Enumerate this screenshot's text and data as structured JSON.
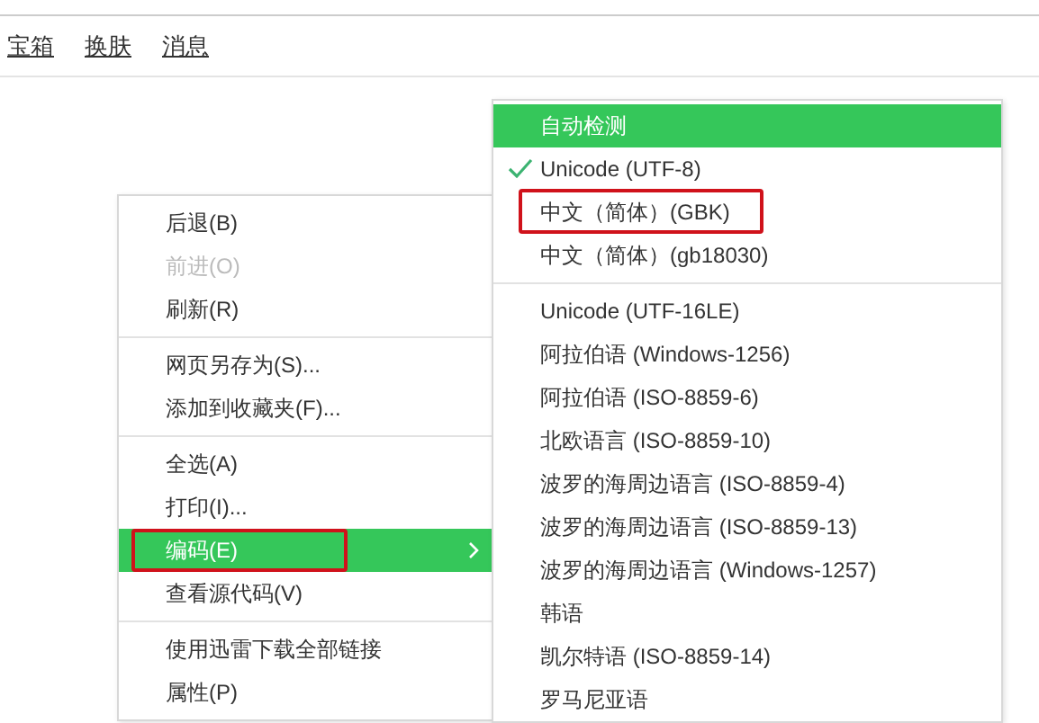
{
  "menu_bar": [
    {
      "label": "宝箱"
    },
    {
      "label": "换肤"
    },
    {
      "label": "消息"
    }
  ],
  "context_menu": {
    "groups": [
      [
        {
          "label": "后退(B)",
          "disabled": false,
          "selected": false,
          "annotated": false
        },
        {
          "label": "前进(O)",
          "disabled": true,
          "selected": false,
          "annotated": false
        },
        {
          "label": "刷新(R)",
          "disabled": false,
          "selected": false,
          "annotated": false
        }
      ],
      [
        {
          "label": "网页另存为(S)...",
          "disabled": false,
          "selected": false,
          "annotated": false
        },
        {
          "label": "添加到收藏夹(F)...",
          "disabled": false,
          "selected": false,
          "annotated": false
        }
      ],
      [
        {
          "label": "全选(A)",
          "disabled": false,
          "selected": false,
          "annotated": false
        },
        {
          "label": "打印(I)...",
          "disabled": false,
          "selected": false,
          "annotated": false
        },
        {
          "label": "编码(E)",
          "disabled": false,
          "selected": true,
          "annotated": true,
          "submenu": true
        },
        {
          "label": "查看源代码(V)",
          "disabled": false,
          "selected": false,
          "annotated": false
        }
      ],
      [
        {
          "label": "使用迅雷下载全部链接",
          "disabled": false,
          "selected": false,
          "annotated": false
        },
        {
          "label": "属性(P)",
          "disabled": false,
          "selected": false,
          "annotated": false
        }
      ]
    ]
  },
  "encoding_menu": {
    "groups": [
      [
        {
          "label": "自动检测",
          "selected": true,
          "checked": false,
          "annotated": false
        },
        {
          "label": "Unicode (UTF-8)",
          "selected": false,
          "checked": true,
          "annotated": false
        },
        {
          "label": "中文（简体）(GBK)",
          "selected": false,
          "checked": false,
          "annotated": true
        },
        {
          "label": "中文（简体）(gb18030)",
          "selected": false,
          "checked": false,
          "annotated": false
        }
      ],
      [
        {
          "label": "Unicode (UTF-16LE)",
          "selected": false,
          "checked": false,
          "annotated": false
        },
        {
          "label": "阿拉伯语 (Windows-1256)",
          "selected": false,
          "checked": false,
          "annotated": false
        },
        {
          "label": "阿拉伯语 (ISO-8859-6)",
          "selected": false,
          "checked": false,
          "annotated": false
        },
        {
          "label": "北欧语言 (ISO-8859-10)",
          "selected": false,
          "checked": false,
          "annotated": false
        },
        {
          "label": "波罗的海周边语言 (ISO-8859-4)",
          "selected": false,
          "checked": false,
          "annotated": false
        },
        {
          "label": "波罗的海周边语言 (ISO-8859-13)",
          "selected": false,
          "checked": false,
          "annotated": false
        },
        {
          "label": "波罗的海周边语言 (Windows-1257)",
          "selected": false,
          "checked": false,
          "annotated": false
        },
        {
          "label": "韩语",
          "selected": false,
          "checked": false,
          "annotated": false
        },
        {
          "label": "凯尔特语 (ISO-8859-14)",
          "selected": false,
          "checked": false,
          "annotated": false
        },
        {
          "label": "罗马尼亚语",
          "selected": false,
          "checked": false,
          "annotated": false
        }
      ]
    ]
  }
}
